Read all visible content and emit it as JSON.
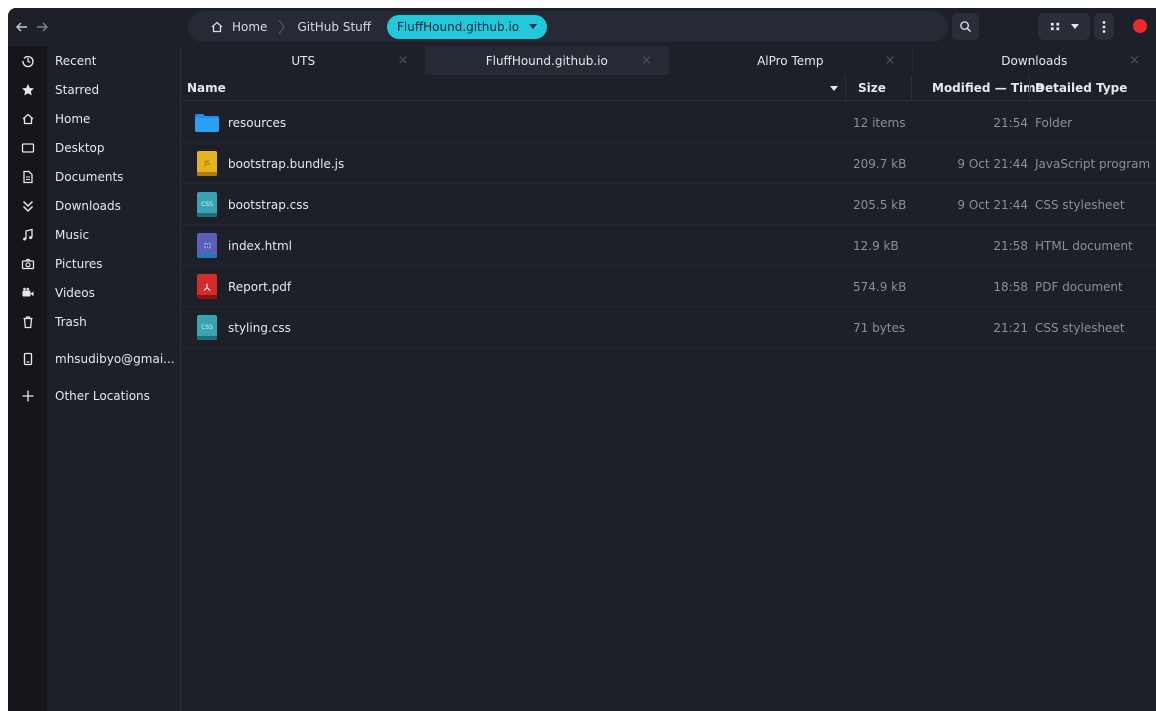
{
  "headerbar": {
    "back": "back-arrow-icon",
    "forward": "forward-arrow-icon",
    "breadcrumb": [
      {
        "label": "Home",
        "icon": "home-icon"
      },
      {
        "label": "GitHub Stuff"
      },
      {
        "label": "FluffHound.github.io",
        "active": true
      }
    ],
    "accent_color": "#22c9dc",
    "close_color": "#ee2a2a"
  },
  "sidebar": {
    "items": [
      {
        "label": "Recent",
        "icon": "recent-icon"
      },
      {
        "label": "Starred",
        "icon": "star-icon"
      },
      {
        "label": "Home",
        "icon": "home-icon"
      },
      {
        "label": "Desktop",
        "icon": "desktop-icon"
      },
      {
        "label": "Documents",
        "icon": "documents-icon"
      },
      {
        "label": "Downloads",
        "icon": "downloads-icon"
      },
      {
        "label": "Music",
        "icon": "music-icon"
      },
      {
        "label": "Pictures",
        "icon": "camera-icon"
      },
      {
        "label": "Videos",
        "icon": "video-icon"
      },
      {
        "label": "Trash",
        "icon": "trash-icon"
      },
      {
        "label": "mhsudibyo@gmai...",
        "icon": "drive-icon"
      },
      {
        "label": "Other Locations",
        "icon": "plus-icon"
      }
    ]
  },
  "tabs": [
    {
      "label": "UTS",
      "active": false
    },
    {
      "label": "FluffHound.github.io",
      "active": true
    },
    {
      "label": "AlPro Temp",
      "active": false
    },
    {
      "label": "Downloads",
      "active": false
    }
  ],
  "tab_close_glyph": "×",
  "columns": {
    "name": "Name",
    "size": "Size",
    "modified": "Modified — Time",
    "type": "Detailed Type"
  },
  "files": [
    {
      "name": "resources",
      "size": "12 items",
      "modified": "21:54",
      "type": "Folder",
      "icon": "folder-icon"
    },
    {
      "name": "bootstrap.bundle.js",
      "size": "209.7 kB",
      "modified": "9 Oct 21:44",
      "type": "JavaScript program",
      "icon": "javascript-file-icon"
    },
    {
      "name": "bootstrap.css",
      "size": "205.5 kB",
      "modified": "9 Oct 21:44",
      "type": "CSS stylesheet",
      "icon": "css-file-icon"
    },
    {
      "name": "index.html",
      "size": "12.9 kB",
      "modified": "21:58",
      "type": "HTML document",
      "icon": "html-file-icon"
    },
    {
      "name": "Report.pdf",
      "size": "574.9 kB",
      "modified": "18:58",
      "type": "PDF document",
      "icon": "pdf-file-icon"
    },
    {
      "name": "styling.css",
      "size": "71 bytes",
      "modified": "21:21",
      "type": "CSS stylesheet",
      "icon": "css-file-icon"
    }
  ]
}
